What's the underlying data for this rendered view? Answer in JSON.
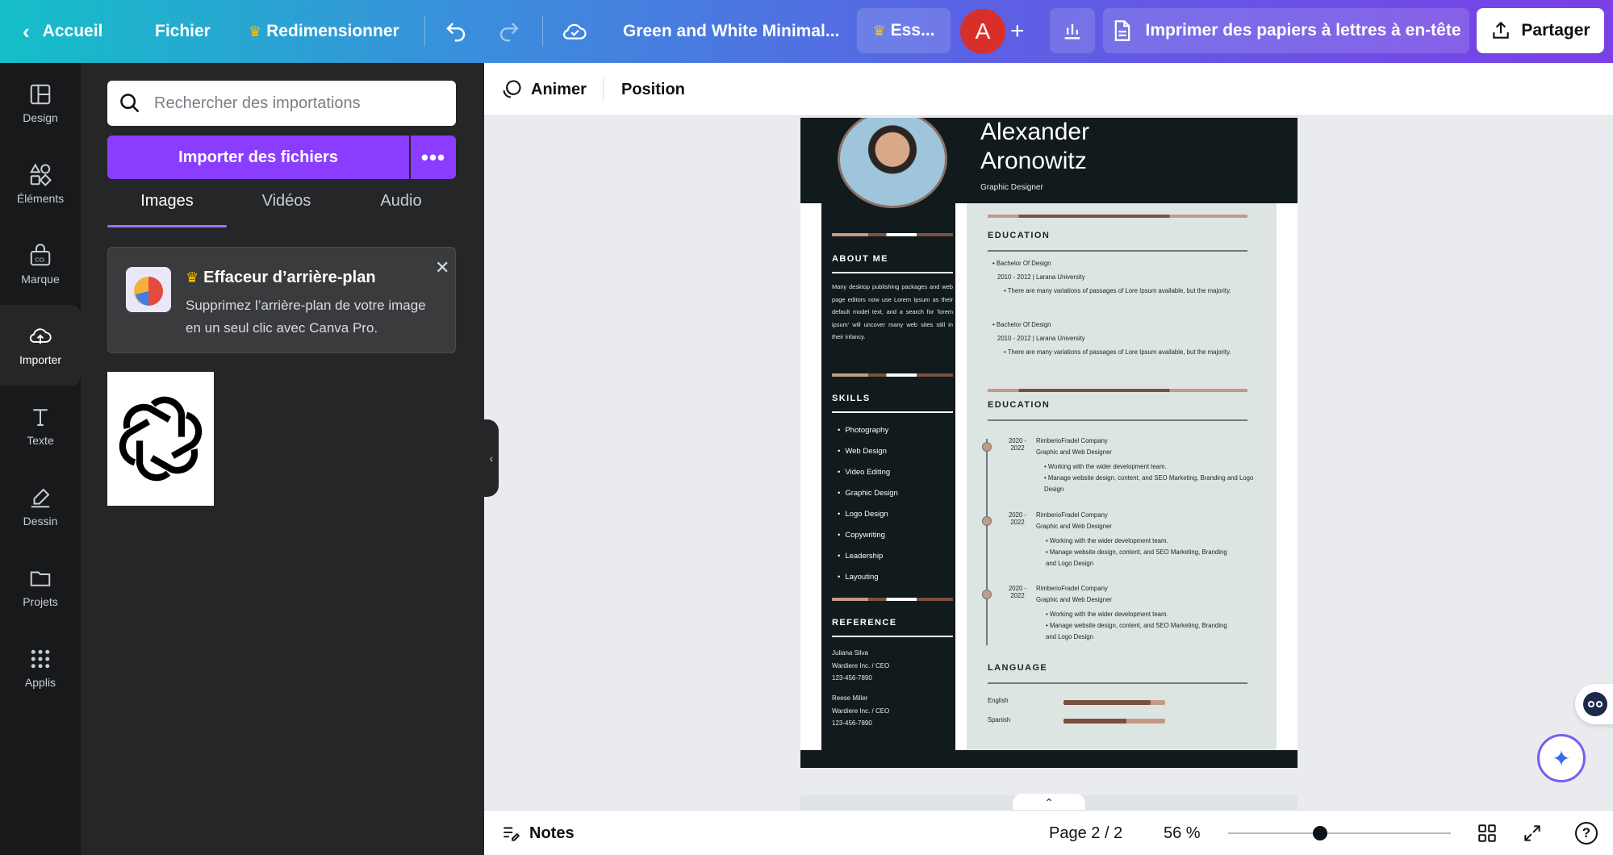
{
  "topbar": {
    "home": "Accueil",
    "file": "Fichier",
    "resize": "Redimensionner",
    "doc_title": "Green and White Minimal...",
    "trial_label": "Ess...",
    "avatar_initial": "A",
    "print_label": "Imprimer des papiers à lettres à en-tête",
    "share_label": "Partager"
  },
  "rail": {
    "items": [
      {
        "label": "Design",
        "icon": "layout-icon"
      },
      {
        "label": "Éléments",
        "icon": "shapes-icon"
      },
      {
        "label": "Marque",
        "icon": "brand-icon"
      },
      {
        "label": "Importer",
        "icon": "cloud-upload-icon"
      },
      {
        "label": "Texte",
        "icon": "text-icon"
      },
      {
        "label": "Dessin",
        "icon": "pen-icon"
      },
      {
        "label": "Projets",
        "icon": "folder-icon"
      },
      {
        "label": "Applis",
        "icon": "apps-icon"
      }
    ]
  },
  "panel": {
    "search_placeholder": "Rechercher des importations",
    "upload_label": "Importer des fichiers",
    "more_label": "•••",
    "tabs": [
      "Images",
      "Vidéos",
      "Audio"
    ],
    "promo": {
      "title": "Effaceur d’arrière-plan",
      "text": "Supprimez l’arrière-plan de votre image en un seul clic avec Canva Pro."
    }
  },
  "context": {
    "animate": "Animer",
    "position": "Position"
  },
  "resume": {
    "first_name": "Alexander",
    "last_name": "Aronowitz",
    "role": "Graphic Designer",
    "about_heading": "ABOUT ME",
    "about_text": "Many desktop publishing packages and web page editors now use Lorem Ipsum as their default model text, and a search for 'lorem ipsum' will uncover many web sites still in their infancy.",
    "skills_heading": "SKILLS",
    "skills": [
      "Photography",
      "Web Design",
      "Video Editing",
      "Graphic Design",
      "Logo Design",
      "Copywriting",
      "Leadership",
      "Layouting"
    ],
    "reference_heading": "REFERENCE",
    "ref1": [
      "Juliana Silva",
      "Wardiere Inc. / CEO",
      "123-456-7890"
    ],
    "ref2": [
      "Reese Miller",
      "Wardiere Inc. / CEO",
      "123-456-7890"
    ],
    "edu_heading": "EDUCATION",
    "edu": [
      {
        "degree": "Bachelor Of Design",
        "years": "2010 - 2012 | Larana University",
        "note": "There are many variations of passages of Lore Ipsum available, but the majority."
      },
      {
        "degree": "Bachelor Of Design",
        "years": "2010 - 2012 | Larana University",
        "note": "There are many variations of passages of Lore Ipsum available, but the majority."
      }
    ],
    "exp_heading": "EDUCATION",
    "exp": [
      {
        "years_a": "2020 -",
        "years_b": "2022",
        "company": "RimberioFradel Company",
        "title": "Graphic and Web Designer",
        "b1": "Working with the wider development team.",
        "b2": "Manage website design, content, and SEO Marketing, Branding and Logo Design"
      },
      {
        "years_a": "2020 -",
        "years_b": "2022",
        "company": "RimberioFradel Company",
        "title": "Graphic and Web Designer",
        "b1": "Working with the wider development team.",
        "b2": "Manage website design, content, and SEO Marketing, Branding and Logo Design"
      },
      {
        "years_a": "2020 -",
        "years_b": "2022",
        "company": "RimberioFradel Company",
        "title": "Graphic and Web Designer",
        "b1": "Working with the wider development team.",
        "b2": "Manage website design, content, and SEO Marketing, Branding and Logo Design"
      }
    ],
    "lang_heading": "LANGUAGE",
    "languages": [
      {
        "name": "English",
        "level": 0.86
      },
      {
        "name": "Spanish",
        "level": 0.62
      }
    ]
  },
  "bottombar": {
    "notes": "Notes",
    "page": "Page 2 / 2",
    "zoom": "56 %",
    "zoom_level": 0.56,
    "help": "?"
  },
  "colors": {
    "accent": "#8b3dff",
    "resume_dark": "#111a1c",
    "resume_light": "#dde5e2",
    "resume_accent": "#c49b82"
  }
}
